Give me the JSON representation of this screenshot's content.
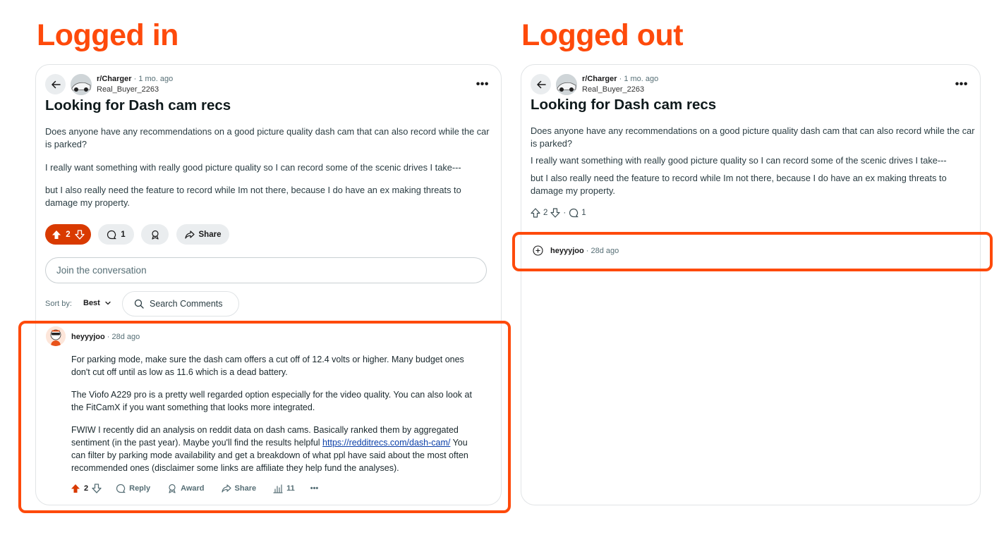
{
  "headings": {
    "left": "Logged in",
    "right": "Logged out"
  },
  "post": {
    "subreddit": "r/Charger",
    "age": "1 mo. ago",
    "author": "Real_Buyer_2263",
    "title": "Looking for Dash cam recs",
    "paragraphs": [
      "Does anyone have any recommendations on a good picture quality dash cam that can also record while the car is parked?",
      "I really want something with really good picture quality so I can record some of the scenic drives I take---",
      "but I also really need the feature to record while Im not there, because I do have an ex making threats to damage my property."
    ],
    "votes": "2",
    "comments": "1",
    "share_label": "Share"
  },
  "join_placeholder": "Join the conversation",
  "sort": {
    "label": "Sort by:",
    "value": "Best"
  },
  "search_comments_placeholder": "Search Comments",
  "comment": {
    "author": "heyyyjoo",
    "age": "28d ago",
    "p1": "For parking mode, make sure the dash cam offers a cut off of 12.4 volts or higher. Many budget ones don't cut off until as low as 11.6 which is a dead battery.",
    "p2": "The Viofo A229 pro is a pretty well regarded option especially for the video quality. You can also look at the FitCamX if you want something that looks more integrated.",
    "p3_before": "FWIW I recently did an analysis on reddit data on dash cams. Basically ranked them by aggregated sentiment (in the past year). Maybe you'll find the results helpful ",
    "p3_link": "https://redditrecs.com/dash-cam/",
    "p3_after": " You can filter by parking mode availability and get a breakdown of what ppl have said about the most often recommended ones (disclaimer some links are affiliate they help fund the analyses).",
    "votes": "2",
    "reply_label": "Reply",
    "award_label": "Award",
    "share_label": "Share",
    "views": "11"
  },
  "colors": {
    "accent": "#fe4a0b",
    "upvote": "#d93a00",
    "link": "#0b3fa8"
  },
  "icons": [
    "back-arrow-icon",
    "more-icon",
    "upvote-icon",
    "downvote-icon",
    "comment-icon",
    "award-icon",
    "share-icon",
    "search-icon",
    "chevron-down-icon",
    "expand-plus-icon",
    "insights-icon"
  ]
}
